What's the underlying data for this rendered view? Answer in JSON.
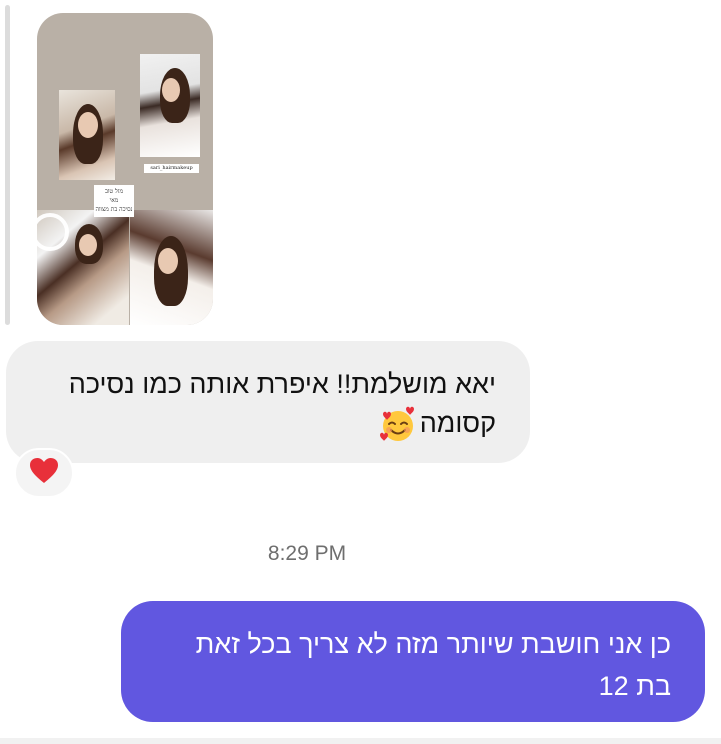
{
  "story_reply": {
    "image_description": "story-photo-collage",
    "credit_tag": "sari_hairmakeup",
    "caption_lines": [
      "מזל טוב",
      "מאי",
      "נסיכה בת מצווה"
    ]
  },
  "messages": [
    {
      "direction": "incoming",
      "line1": "יאא מושלמת!! איפרת אותה כמו נסיכה",
      "line2": "קסומה",
      "emoji": "smiling-face-with-hearts",
      "reaction": "❤️"
    },
    {
      "direction": "outgoing",
      "line1": "כן אני חושבת שיותר מזה לא צריך בכל זאת",
      "line2": "בת 12"
    }
  ],
  "timestamp": "8:29 PM",
  "colors": {
    "incoming_bubble": "#efefef",
    "outgoing_bubble": "#6157e0",
    "timestamp_text": "#6e6e6e"
  }
}
